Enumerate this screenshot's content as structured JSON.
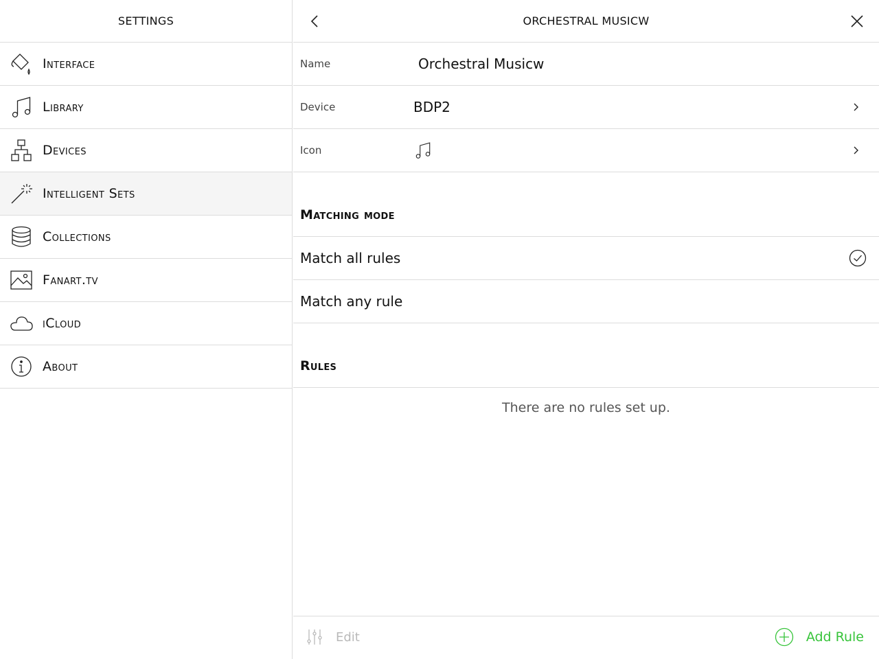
{
  "left": {
    "title": "Settings",
    "items": [
      {
        "label": "Interface",
        "icon": "paint-bucket-icon"
      },
      {
        "label": "Library",
        "icon": "music-note-icon"
      },
      {
        "label": "Devices",
        "icon": "network-icon"
      },
      {
        "label": "Intelligent Sets",
        "icon": "magic-wand-icon",
        "active": true
      },
      {
        "label": "Collections",
        "icon": "database-icon"
      },
      {
        "label": "Fanart.tv",
        "icon": "image-icon"
      },
      {
        "label": "iCloud",
        "icon": "cloud-icon"
      },
      {
        "label": "About",
        "icon": "info-icon"
      }
    ]
  },
  "right": {
    "title": "ORCHESTRAL MUSICW",
    "name_label": "Name",
    "name_value": "Orchestral Musicw",
    "device_label": "Device",
    "device_value": "BDP2",
    "icon_label": "Icon",
    "icon_value": "music-note-icon",
    "matching_title": "Matching mode",
    "options": [
      {
        "label": "Match all rules",
        "selected": true
      },
      {
        "label": "Match any rule",
        "selected": false
      }
    ],
    "rules_title": "Rules",
    "empty_text": "There are no rules set up."
  },
  "toolbar": {
    "edit_label": "Edit",
    "add_label": "Add Rule",
    "accent_color": "#37c43a",
    "disabled_color": "#b9b9b9"
  }
}
